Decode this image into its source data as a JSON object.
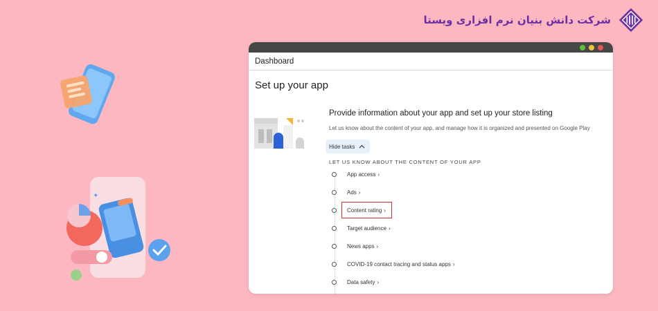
{
  "brand": {
    "name": "شرکت دانش بنیان نرم افزاری ویستا"
  },
  "window": {
    "controls": [
      "close",
      "minimize",
      "maximize"
    ],
    "breadcrumb": "Dashboard",
    "page_title": "Set up your app",
    "heading": "Provide information about your app and set up your store listing",
    "subtext": "Let us know about the content of your app, and manage how it is organized and presented on Google Play",
    "hide_tasks_label": "Hide tasks",
    "section_label": "LET US KNOW ABOUT THE CONTENT OF YOUR APP",
    "tasks": [
      {
        "label": "App access",
        "highlighted": false
      },
      {
        "label": "Ads",
        "highlighted": false
      },
      {
        "label": "Content rating",
        "highlighted": true
      },
      {
        "label": "Target audience",
        "highlighted": false
      },
      {
        "label": "News apps",
        "highlighted": false
      },
      {
        "label": "COVID-19 contact tracing and status apps",
        "highlighted": false
      },
      {
        "label": "Data safety",
        "highlighted": false
      }
    ]
  },
  "colors": {
    "background": "#fdb7c0",
    "brand": "#6a2fa3",
    "titlebar": "#464646",
    "highlight": "#d42f2f",
    "dot_green": "#5fbf3c",
    "dot_yellow": "#f0c33c",
    "dot_red": "#e8564f"
  },
  "icons": {
    "brand_logo": "vista-logo-icon",
    "chevron_up": "chevron-up-icon",
    "chevron_right": "chevron-right-icon"
  }
}
